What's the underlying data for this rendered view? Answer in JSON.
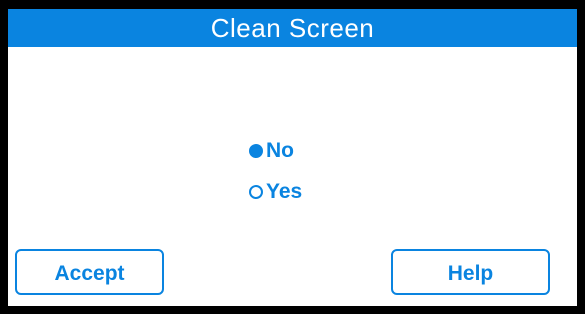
{
  "window": {
    "title": "Clean Screen"
  },
  "options": {
    "items": [
      {
        "label": "No",
        "selected": true
      },
      {
        "label": "Yes",
        "selected": false
      }
    ]
  },
  "buttons": {
    "accept_label": "Accept",
    "help_label": "Help"
  },
  "colors": {
    "accent": "#0a84e0",
    "background": "#ffffff",
    "frame": "#000000",
    "title_text": "#ffffff"
  },
  "icons": {
    "selected_radio": "radio-filled-icon",
    "unselected_radio": "radio-empty-icon"
  }
}
